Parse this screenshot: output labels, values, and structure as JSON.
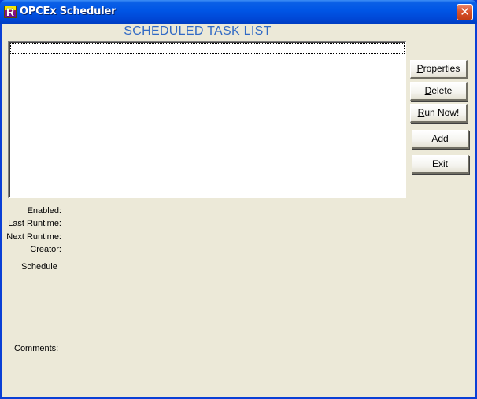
{
  "window": {
    "title": "OPCEx Scheduler",
    "app_icon": "r-logo-icon",
    "close_icon": "close-icon",
    "close_glyph": "✕"
  },
  "heading": "SCHEDULED TASK LIST",
  "task_list": {
    "items": []
  },
  "buttons": {
    "properties": {
      "mnemonic": "P",
      "rest": "roperties"
    },
    "delete": {
      "mnemonic": "D",
      "rest": "elete"
    },
    "run_now": {
      "mnemonic": "R",
      "rest": "un Now!"
    },
    "add": "Add",
    "exit": "Exit"
  },
  "details": {
    "enabled_label": "Enabled:",
    "last_runtime_label": "Last Runtime:",
    "next_runtime_label": "Next Runtime:",
    "creator_label": "Creator:",
    "schedule_label": "Schedule",
    "comments_label": "Comments:"
  },
  "colors": {
    "heading": "#316ac5",
    "titlebar": "#0055e5",
    "client_bg": "#ece9d8"
  }
}
